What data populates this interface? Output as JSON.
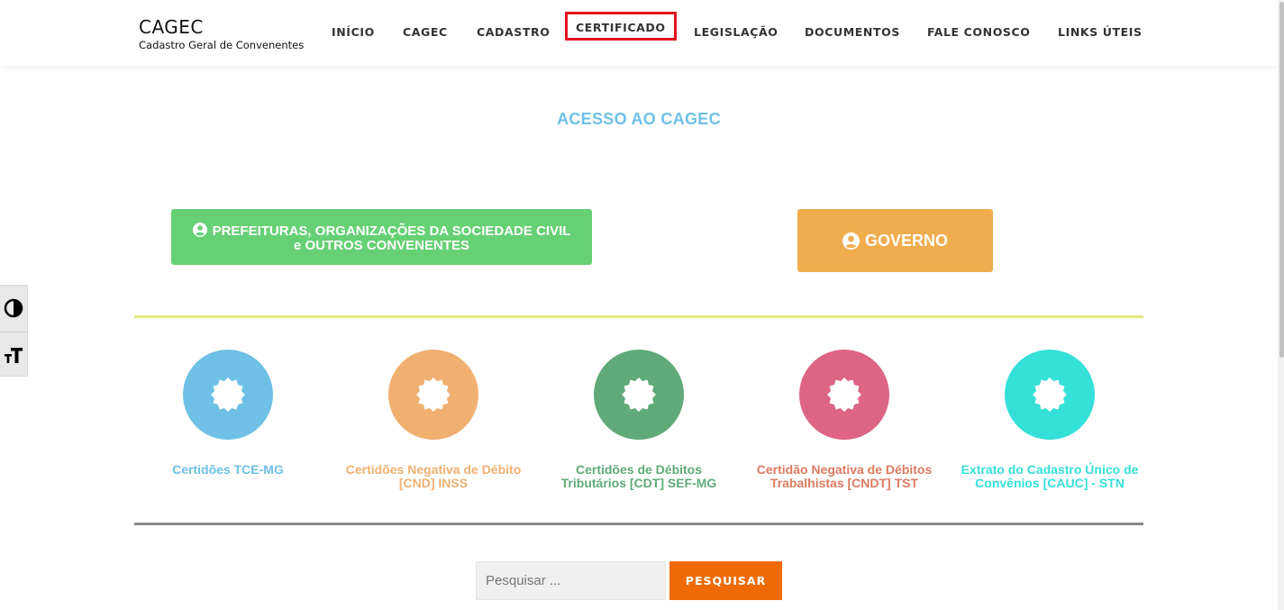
{
  "brand": {
    "title": "CAGEC",
    "subtitle": "Cadastro Geral de Convenentes"
  },
  "nav": [
    "INÍCIO",
    "CAGEC",
    "CADASTRO",
    "CERTIFICADO",
    "LEGISLAÇÃO",
    "DOCUMENTOS",
    "FALE CONOSCO",
    "LINKS ÚTEIS"
  ],
  "nav_highlighted": "CERTIFICADO",
  "section_title": "ACESSO AO CAGEC",
  "buttons": {
    "convenentes_line1": "PREFEITURAS, ORGANIZAÇÕES DA SOCIEDADE CIVIL",
    "convenentes_line2": "e OUTROS CONVENENTES",
    "governo": "GOVERNO"
  },
  "certificates": [
    {
      "line1": "Certidões TCE-MG",
      "line2": "",
      "color": "#6ec0e6",
      "text_color": "#6ec0e6"
    },
    {
      "line1": "Certidões Negativa de Débito",
      "line2": "[CND] INSS",
      "color": "#f0b070",
      "text_color": "#f0b070"
    },
    {
      "line1": "Certidões de Débitos",
      "line2": "Tributários [CDT] SEF-MG",
      "color": "#5faa78",
      "text_color": "#5faa78"
    },
    {
      "line1": "Certidão Negativa de Débitos",
      "line2": "Trabalhistas [CNDT] TST",
      "color": "#dd6485",
      "text_color": "#dd7a60"
    },
    {
      "line1": "Extrato do Cadastro Único de",
      "line2": "Convênios [CAUC] - STN",
      "color": "#34e0d8",
      "text_color": "#34e0d8"
    }
  ],
  "search": {
    "placeholder": "Pesquisar ...",
    "button": "PESQUISAR"
  },
  "icons": {
    "contrast": "contrast-icon",
    "font_size": "font-size-icon",
    "user": "user-circle-icon",
    "badge": "badge-certificate-icon"
  },
  "colors": {
    "highlight": "#e0141e",
    "green": "#66d074",
    "orange": "#f0ad4e",
    "search_btn": "#ef6a05"
  }
}
